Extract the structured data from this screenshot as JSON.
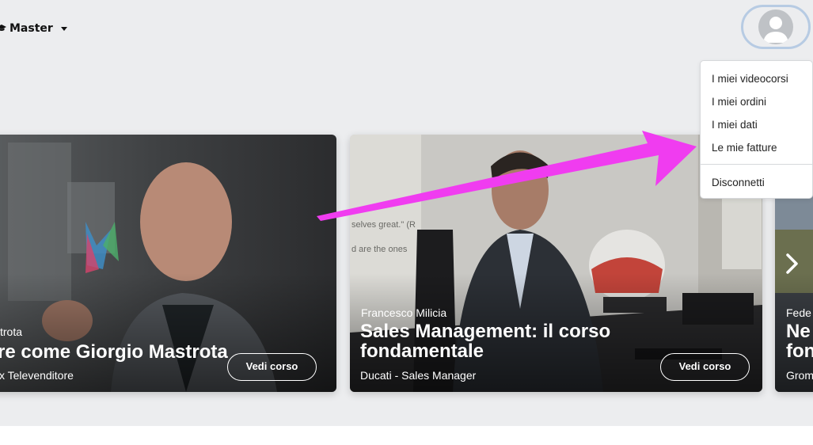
{
  "header": {
    "master_label": "Master",
    "avatar_icon": "user-avatar-icon"
  },
  "dropdown": {
    "items": [
      "I miei videocorsi",
      "I miei ordini",
      "I miei dati",
      "Le mie fatture"
    ],
    "logout": "Disconnetti"
  },
  "cards": [
    {
      "teacher": "trota",
      "title": "re come Giorgio Mastrota",
      "role": "x Televenditore",
      "button": "Vedi corso"
    },
    {
      "teacher": "Francesco Milicia",
      "title_line1": "Sales Management: il corso",
      "title_line2": "fondamentale",
      "role": "Ducati - Sales Manager",
      "button": "Vedi corso"
    },
    {
      "teacher": "Fede",
      "title_line1": "Ne",
      "title_line2": "fon",
      "role": "Grom"
    }
  ],
  "annotation": {
    "arrow_color": "#f03cf0"
  }
}
